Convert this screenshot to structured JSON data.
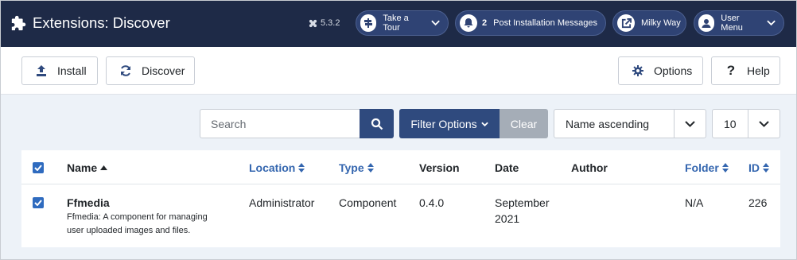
{
  "header": {
    "title": "Extensions: Discover",
    "version": "5.3.2",
    "tour_label": "Take a Tour",
    "messages_count": "2",
    "messages_label": "Post Installation Messages",
    "site_label": "Milky Way",
    "user_menu_label": "User Menu"
  },
  "toolbar": {
    "install_label": "Install",
    "discover_label": "Discover",
    "options_label": "Options",
    "help_label": "Help"
  },
  "filters": {
    "search_placeholder": "Search",
    "filter_options_label": "Filter Options",
    "clear_label": "Clear",
    "sort_value": "Name ascending",
    "limit_value": "10"
  },
  "table": {
    "columns": {
      "name": "Name",
      "location": "Location",
      "type": "Type",
      "version": "Version",
      "date": "Date",
      "author": "Author",
      "folder": "Folder",
      "id": "ID"
    },
    "rows": [
      {
        "name": "Ffmedia",
        "description_line1": "Ffmedia: A component for managing",
        "description_line2": "user uploaded images and files.",
        "location": "Administrator",
        "type": "Component",
        "version": "0.4.0",
        "date_line1": "September",
        "date_line2": "2021",
        "author": "",
        "folder": "N/A",
        "id": "226",
        "checked": true
      }
    ]
  },
  "colors": {
    "header_bg": "#1e2a47",
    "primary": "#2f4a7e",
    "link": "#3466af",
    "checkbox": "#2f6bbf",
    "clear_bg": "#a5adb7"
  }
}
